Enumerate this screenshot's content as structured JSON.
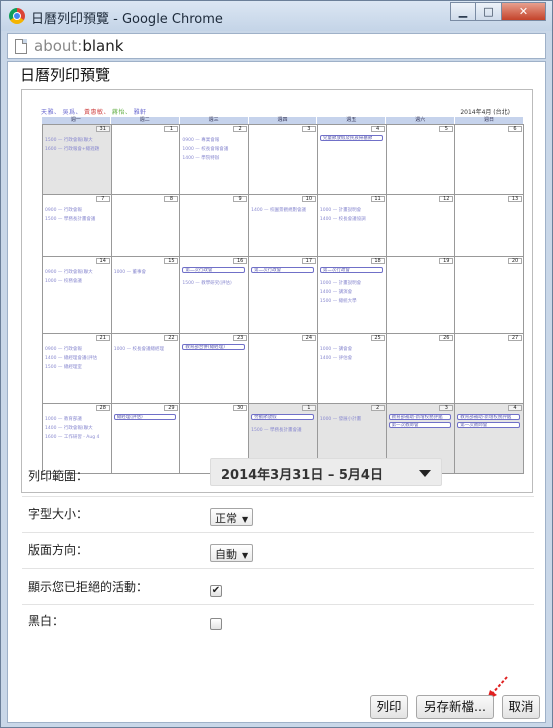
{
  "window": {
    "title": "日曆列印預覽 - Google Chrome",
    "min_icon": "minimize-icon",
    "max_icon": "maximize-icon",
    "close_icon": "close-icon"
  },
  "address": {
    "scheme": "about:",
    "rest": "blank"
  },
  "page_title": "日曆列印預覽",
  "preview": {
    "legend": [
      "天雅",
      "吳爲",
      "黃惠敏",
      "蔣怡",
      "雅軒"
    ],
    "legend_colors": [
      "#6a6ad0",
      "#6a6ad0",
      "#d04848",
      "#5aaa3a",
      "#6a6ad0"
    ],
    "month_label": "2014年4月 (台北)",
    "weekdays": [
      "週一",
      "週二",
      "週三",
      "週四",
      "週五",
      "週六",
      "週日"
    ],
    "weeks": [
      [
        {
          "num": "31",
          "gray": true,
          "events": [
            "1500 — 行政會報(聯大",
            "1600 — 行政報會+總週題"
          ],
          "boxes": []
        },
        {
          "num": "1",
          "gray": false,
          "events": [],
          "boxes": []
        },
        {
          "num": "2",
          "gray": false,
          "events": [
            "0900 — 專業會報",
            "1000 — 校長會報會議",
            "1400 — 學院特辦"
          ],
          "boxes": []
        },
        {
          "num": "3",
          "gray": false,
          "events": [],
          "boxes": []
        },
        {
          "num": "4",
          "gray": false,
          "events": [],
          "boxes": [
            "兒童節放假及民族掃墓節"
          ]
        },
        {
          "num": "5",
          "gray": false,
          "events": [],
          "boxes": []
        },
        {
          "num": "6",
          "gray": false,
          "events": [],
          "boxes": []
        }
      ],
      [
        {
          "num": "7",
          "gray": false,
          "events": [
            "0900 — 行政會報",
            "1500 — 學務長計畫會議"
          ],
          "boxes": []
        },
        {
          "num": "8",
          "gray": false,
          "events": [],
          "boxes": []
        },
        {
          "num": "9",
          "gray": false,
          "events": [],
          "boxes": []
        },
        {
          "num": "10",
          "gray": false,
          "events": [
            "1400 — 校園景觀規劃會議"
          ],
          "boxes": []
        },
        {
          "num": "11",
          "gray": false,
          "events": [
            "1000 — 計畫說明會",
            "1400 — 校長會議協調"
          ],
          "boxes": []
        },
        {
          "num": "12",
          "gray": false,
          "events": [],
          "boxes": []
        },
        {
          "num": "13",
          "gray": false,
          "events": [],
          "boxes": []
        }
      ],
      [
        {
          "num": "14",
          "gray": false,
          "events": [
            "0900 — 行政會報(聯大",
            "1000 — 校務會議"
          ],
          "boxes": []
        },
        {
          "num": "15",
          "gray": false,
          "events": [
            "1000 — 董事會"
          ],
          "boxes": []
        },
        {
          "num": "16",
          "gray": false,
          "events": [
            "1500 — 教學研究(評估)"
          ],
          "boxes": [
            "第二次行政會"
          ]
        },
        {
          "num": "17",
          "gray": false,
          "events": [],
          "boxes": [
            "第二次行政會"
          ]
        },
        {
          "num": "18",
          "gray": false,
          "events": [
            "1000 — 計畫說明會",
            "1400 — 講演會",
            "1500 — 總統大學"
          ],
          "boxes": [
            "第二次行政會"
          ]
        },
        {
          "num": "19",
          "gray": false,
          "events": [],
          "boxes": []
        },
        {
          "num": "20",
          "gray": false,
          "events": [],
          "boxes": []
        }
      ],
      [
        {
          "num": "21",
          "gray": false,
          "events": [
            "0900 — 行政會報",
            "1400 — 總經理會議(評估",
            "1500 — 總經理室"
          ],
          "boxes": []
        },
        {
          "num": "22",
          "gray": false,
          "events": [
            "1000 — 校長會議總經理"
          ],
          "boxes": []
        },
        {
          "num": "23",
          "gray": false,
          "events": [],
          "boxes": [
            "教育部合併(總經理)"
          ]
        },
        {
          "num": "24",
          "gray": false,
          "events": [],
          "boxes": []
        },
        {
          "num": "25",
          "gray": false,
          "events": [
            "1000 — 講會會",
            "1400 — 評估會"
          ],
          "boxes": []
        },
        {
          "num": "26",
          "gray": false,
          "events": [],
          "boxes": []
        },
        {
          "num": "27",
          "gray": false,
          "events": [],
          "boxes": []
        }
      ],
      [
        {
          "num": "28",
          "gray": false,
          "events": [
            "1000 — 教育部議",
            "1400 — 行政會報(聯大",
            "1600 — 工作研習 - Aug 4"
          ],
          "boxes": []
        },
        {
          "num": "29",
          "gray": false,
          "events": [],
          "boxes": [
            "總經理(評估)"
          ]
        },
        {
          "num": "30",
          "gray": false,
          "events": [],
          "boxes": []
        },
        {
          "num": "1",
          "gray": true,
          "events": [
            "1500 — 學務長計畫會議"
          ],
          "boxes": [
            "勞動節放假"
          ]
        },
        {
          "num": "2",
          "gray": true,
          "events": [
            "1000 — 發展小計畫"
          ],
          "boxes": []
        },
        {
          "num": "3",
          "gray": true,
          "events": [],
          "boxes": [
            "教育部補助-新增校務評鑑",
            "第一次教師會"
          ]
        },
        {
          "num": "4",
          "gray": true,
          "events": [],
          "boxes": [
            "教育部補助-新增校務評鑑",
            "第一次教師會"
          ]
        }
      ]
    ]
  },
  "settings": {
    "range_label": "列印範圍：",
    "range_value": "2014年3月31日 – 5月4日",
    "font_label": "字型大小：",
    "font_value": "正常",
    "orient_label": "版面方向：",
    "orient_value": "自動",
    "declined_label": "顯示您已拒絕的活動：",
    "declined_check": "✔",
    "bw_label": "黑白："
  },
  "buttons": {
    "print": "列印",
    "save_as": "另存新檔...",
    "cancel": "取消"
  },
  "colors": {
    "window_frame": "#c9d7e8",
    "calendar_header": "#c6d3ec",
    "event_text": "#8a8ad0",
    "event_border": "#7070c8",
    "hint_arrow": "#e02020"
  }
}
